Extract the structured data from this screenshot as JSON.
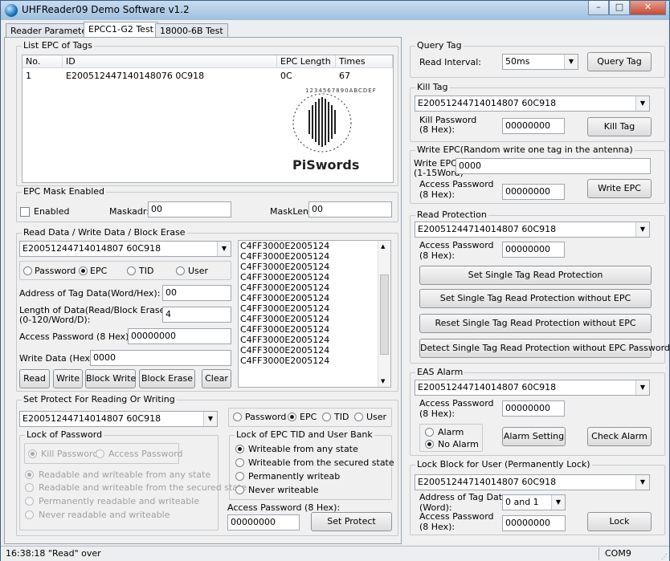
{
  "window": {
    "title": "UHFReader09 Demo Software v1.2",
    "minimize_glyph": "–",
    "maximize_glyph": "□",
    "close_glyph": "✕"
  },
  "tabs": [
    "Reader Parameter",
    "EPCC1-G2 Test",
    "18000-6B Test"
  ],
  "list_epc": {
    "title": "List EPC of Tags",
    "columns": [
      "No.",
      "ID",
      "EPC Length",
      "Times"
    ],
    "rows": [
      {
        "no": "1",
        "id": "E200512447140148076 0C918",
        "epc_length": "0C",
        "times": "67"
      }
    ],
    "logo_text": "PiSwords",
    "logo_digits": "1234567890ABCDEF"
  },
  "mask": {
    "title": "EPC Mask Enabled",
    "enabled_label": "Enabled",
    "maskadr_label": "Maskadr:",
    "maskadr_value": "00",
    "masklen_label": "MaskLen:",
    "masklen_value": "00"
  },
  "rw": {
    "title": "Read Data / Write Data / Block Erase",
    "epc_value": "E20051244714014807 60C918",
    "bank_password": "Password",
    "bank_epc": "EPC",
    "bank_tid": "TID",
    "bank_user": "User",
    "address_label": "Address of Tag Data(Word/Hex):",
    "address_value": "00",
    "length_label_1": "Length of Data(Read/Block Erase)",
    "length_label_2": "(0-120/Word/D):",
    "length_value": "4",
    "access_label": "Access Password (8 Hex):",
    "access_value": "00000000",
    "write_label": "Write Data (Hex):",
    "write_value": "0000",
    "btn_read": "Read",
    "btn_write": "Write",
    "btn_block_write": "Block Write",
    "btn_block_erase": "Block Erase",
    "btn_clear": "Clear",
    "memo_lines": [
      "C4FF3000E2005124",
      "C4FF3000E2005124",
      "C4FF3000E2005124",
      "C4FF3000E2005124",
      "C4FF3000E2005124",
      "C4FF3000E2005124",
      "C4FF3000E2005124",
      "C4FF3000E2005124",
      "C4FF3000E2005124",
      "C4FF3000E2005124",
      "C4FF3000E2005124",
      "C4FF3000E2005124"
    ]
  },
  "protect": {
    "title": "Set Protect For Reading Or Writing",
    "epc_value": "E20051244714014807 60C918",
    "bank_password": "Password",
    "bank_epc": "EPC",
    "bank_tid": "TID",
    "bank_user": "User",
    "lock_pw_title": "Lock of Password",
    "kill_password": "Kill Password",
    "access_password": "Access Password",
    "opt1": "Readable and  writeable from any state",
    "opt2": "Readable and writeable from the secured state",
    "opt3": "Permanently readable and writeable",
    "opt4": "Never readable and writeable",
    "lock_bank_title": "Lock of EPC TID and User Bank",
    "bank_opt1": "Writeable from any state",
    "bank_opt2": "Writeable from the secured state",
    "bank_opt3": "Permanently writeab",
    "bank_opt4": "Never writeable",
    "access_label": "Access Password (8 Hex):",
    "access_value": "00000000",
    "btn_set_protect": "Set Protect"
  },
  "query": {
    "title": "Query Tag",
    "interval_label": "Read Interval:",
    "interval_value": "50ms",
    "btn_query": "Query Tag"
  },
  "kill": {
    "title": "Kill Tag",
    "epc_value": "E20051244714014807 60C918",
    "pw_label_1": "Kill Password",
    "pw_label_2": "(8 Hex):",
    "pw_value": "00000000",
    "btn_kill": "Kill Tag"
  },
  "write_epc": {
    "title": "Write EPC(Random write one tag in the antenna)",
    "epc_label_1": "Write EPC:",
    "epc_label_2": "(1-15Word)",
    "epc_value": "0000",
    "pw_label_1": "Access Password",
    "pw_label_2": "(8 Hex):",
    "pw_value": "00000000",
    "btn_write": "Write EPC"
  },
  "read_protect": {
    "title": "Read Protection",
    "epc_value": "E20051244714014807 60C918",
    "pw_label_1": "Access Password",
    "pw_label_2": "(8 Hex):",
    "pw_value": "00000000",
    "btn_set_single": "Set Single Tag Read Protection",
    "btn_set_without": "Set Single Tag Read Protection without EPC",
    "btn_reset_without": "Reset Single Tag Read Protection without EPC",
    "btn_detect": "Detect Single Tag Read Protection without EPC Password"
  },
  "eas": {
    "title": "EAS Alarm",
    "epc_value": "E20051244714014807 60C918",
    "pw_label_1": "Access Password",
    "pw_label_2": "(8 Hex):",
    "pw_value": "00000000",
    "alarm": "Alarm",
    "no_alarm": "No Alarm",
    "btn_alarm_setting": "Alarm Setting",
    "btn_check_alarm": "Check Alarm"
  },
  "lock_block": {
    "title": "Lock Block for User (Permanently Lock)",
    "epc_value": "E20051244714014807 60C918",
    "addr_label_1": "Address of Tag Data",
    "addr_label_2": "(Word):",
    "addr_value": "0 and 1",
    "pw_label_1": "Access Password",
    "pw_label_2": "(8 Hex):",
    "pw_value": "00000000",
    "btn_lock": "Lock"
  },
  "status": {
    "message": "16:38:18 \"Read\" over",
    "port": "COM9"
  }
}
